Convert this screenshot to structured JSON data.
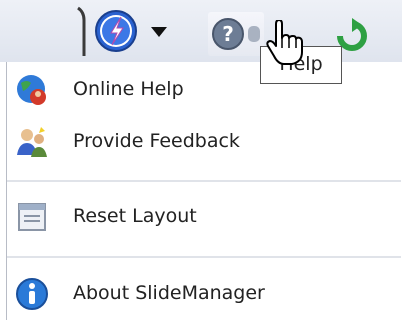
{
  "toolbar": {
    "help_menu_icon": "help-lightning-icon",
    "help_icon": "question-icon",
    "refresh_icon": "refresh-icon"
  },
  "tooltip": {
    "text": "Help"
  },
  "menu": {
    "items": [
      {
        "label": "Online Help",
        "icon": "globe-help-icon"
      },
      {
        "label": "Provide Feedback",
        "icon": "feedback-people-icon"
      },
      {
        "label": "Reset Layout",
        "icon": "layout-window-icon"
      },
      {
        "label": "About SlideManager",
        "icon": "info-icon"
      }
    ]
  },
  "colors": {
    "accent_blue": "#2a62d0",
    "refresh_green": "#2ea043",
    "menu_border": "#b8bcc6"
  }
}
